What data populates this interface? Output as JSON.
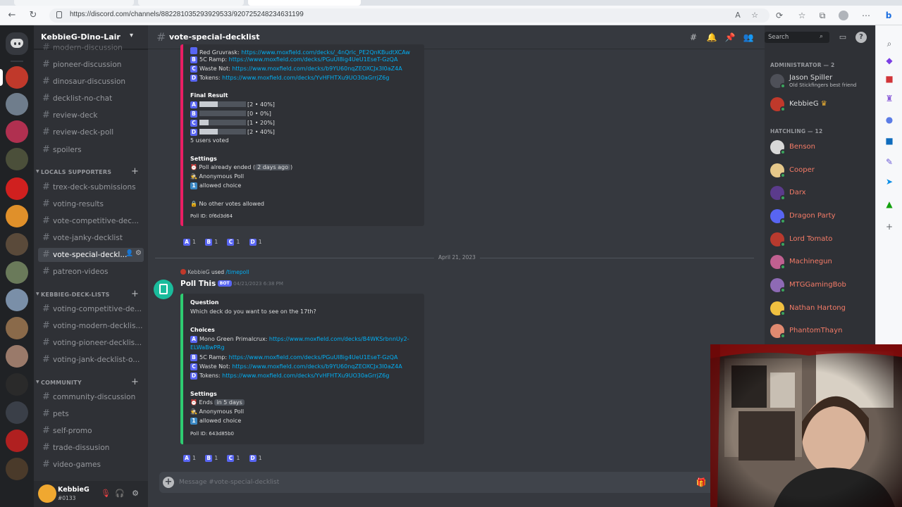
{
  "browser": {
    "url": "https://discord.com/channels/882281035293929533/920725248234631199"
  },
  "server": {
    "name": "KebbieG-Dino-Lair"
  },
  "channels": {
    "top": [
      "modern-discussion",
      "pioneer-discussion",
      "dinosaur-discussion",
      "decklist-no-chat",
      "review-deck",
      "review-deck-poll",
      "spoilers"
    ],
    "category_locals": "LOCALS SUPPORTERS",
    "locals": [
      "trex-deck-submissions",
      "voting-results",
      "vote-competitive-dec...",
      "vote-janky-decklist",
      "vote-special-deckl...",
      "patreon-videos"
    ],
    "category_decklists": "KEBBIEG-DECK-LISTS",
    "decklists": [
      "voting-competitive-de...",
      "voting-modern-decklis...",
      "voting-pioneer-decklis...",
      "voting-jank-decklist-o..."
    ],
    "category_community": "COMMUNITY",
    "community": [
      "community-discussion",
      "pets",
      "self-promo",
      "trade-dissusion",
      "video-games"
    ]
  },
  "user": {
    "name": "KebbieG",
    "tag": "#0133"
  },
  "chat": {
    "title": "vote-special-decklist",
    "input_placeholder": "Message #vote-special-decklist",
    "poll1": {
      "choices": [
        {
          "letter": "",
          "label": "Red Gruvrask:",
          "url": "https://www.moxfield.com/decks/_4nQrlc_PE2QnKBudtXCAw"
        },
        {
          "letter": "B",
          "label": "5C Ramp:",
          "url": "https://www.moxfield.com/decks/PGuUl8ig4UeU1EseT-GzQA"
        },
        {
          "letter": "C",
          "label": "Waste Not:",
          "url": "https://www.moxfield.com/decks/b9YU60nqZEOXCJx3I0aZ4A"
        },
        {
          "letter": "D",
          "label": "Tokens:",
          "url": "https://www.moxfield.com/decks/YvHFHTXu9UO30aGrrjZ6g"
        }
      ],
      "final_result_heading": "Final Result",
      "results": [
        {
          "letter": "A",
          "label": "[2 • 40%]",
          "pct": 40
        },
        {
          "letter": "B",
          "label": "[0 • 0%]",
          "pct": 0
        },
        {
          "letter": "C",
          "label": "[1 • 20%]",
          "pct": 20
        },
        {
          "letter": "D",
          "label": "[2 • 40%]",
          "pct": 40
        }
      ],
      "votes_text": "5 users voted",
      "settings_heading": "Settings",
      "ended_prefix": "Poll already ended (",
      "ended_chip": "2 days ago",
      "ended_suffix": ")",
      "anonymous": "Anonymous Poll",
      "allowed_num": "1",
      "allowed_text": "allowed choice",
      "no_votes": "No other votes allowed",
      "poll_id": "Poll ID: 0f6d3d64",
      "reactions": [
        {
          "letter": "A",
          "count": "1"
        },
        {
          "letter": "B",
          "count": "1"
        },
        {
          "letter": "C",
          "count": "1"
        },
        {
          "letter": "D",
          "count": "1"
        }
      ]
    },
    "date_divider": "April 21, 2023",
    "poll2": {
      "reply_user": "KebbieG",
      "reply_used": "used",
      "reply_command": "/timepoll",
      "author": "Poll This",
      "bot_badge": "BOT",
      "timestamp": "04/21/2023 6:38 PM",
      "question_heading": "Question",
      "question": "Which deck do you want to see on the 17th?",
      "choices_heading": "Choices",
      "choices": [
        {
          "letter": "A",
          "label": "Mono Green Primalcrux:",
          "url": "https://www.moxfield.com/decks/B4WKSrbnnUy2-",
          "url2": "ELWaBwPRg"
        },
        {
          "letter": "B",
          "label": "5C Ramp:",
          "url": "https://www.moxfield.com/decks/PGuUl8ig4UeU1EseT-GzQA"
        },
        {
          "letter": "C",
          "label": "Waste Not:",
          "url": "https://www.moxfield.com/decks/b9YU60nqZEOXCJx3I0aZ4A"
        },
        {
          "letter": "D",
          "label": "Tokens:",
          "url": "https://www.moxfield.com/decks/YvHFHTXu9UO30aGrrjZ6g"
        }
      ],
      "settings_heading": "Settings",
      "ends_prefix": "Ends",
      "ends_chip": "in 5 days",
      "anonymous": "Anonymous Poll",
      "allowed_num": "1",
      "allowed_text": "allowed choice",
      "poll_id": "Poll ID: 643d85b0",
      "reactions": [
        {
          "letter": "A",
          "count": "1"
        },
        {
          "letter": "B",
          "count": "1"
        },
        {
          "letter": "C",
          "count": "1"
        },
        {
          "letter": "D",
          "count": "1"
        }
      ]
    }
  },
  "members": {
    "search_placeholder": "Search",
    "group_admin": "ADMINISTRATOR — 2",
    "admins": [
      {
        "name": "Jason Spiller",
        "status": "Old Stickfingers best friend",
        "color": "#dcddde",
        "avatar": "#4e5058"
      },
      {
        "name": "KebbieG",
        "status": "",
        "color": "#dcddde",
        "avatar": "#c0392b"
      }
    ],
    "group_hatchling": "HATCHLING — 12",
    "hatchlings": [
      {
        "name": "Benson",
        "color": "#f47b67",
        "avatar": "#d8d8d8"
      },
      {
        "name": "Cooper",
        "color": "#f47b67",
        "avatar": "#e6c88a"
      },
      {
        "name": "Darx",
        "color": "#f47b67",
        "avatar": "#5b3b8c"
      },
      {
        "name": "Dragon Party",
        "color": "#f47b67",
        "avatar": "#5865f2"
      },
      {
        "name": "Lord Tomato",
        "color": "#f47b67",
        "avatar": "#b83a2e"
      },
      {
        "name": "Machinegun",
        "color": "#f47b67",
        "avatar": "#c06090"
      },
      {
        "name": "MTGGamingBob",
        "color": "#f47b67",
        "avatar": "#8e6ab5"
      },
      {
        "name": "Nathan Hartong",
        "color": "#f47b67",
        "avatar": "#f0c040"
      },
      {
        "name": "PhantomThayn",
        "color": "#f47b67",
        "avatar": "#e08a70"
      }
    ]
  },
  "colors": {
    "accent": "#5865f2",
    "link": "#00aff4",
    "online": "#3ba55d",
    "embed_old": "#e91e63",
    "embed_new": "#2ecc71"
  }
}
